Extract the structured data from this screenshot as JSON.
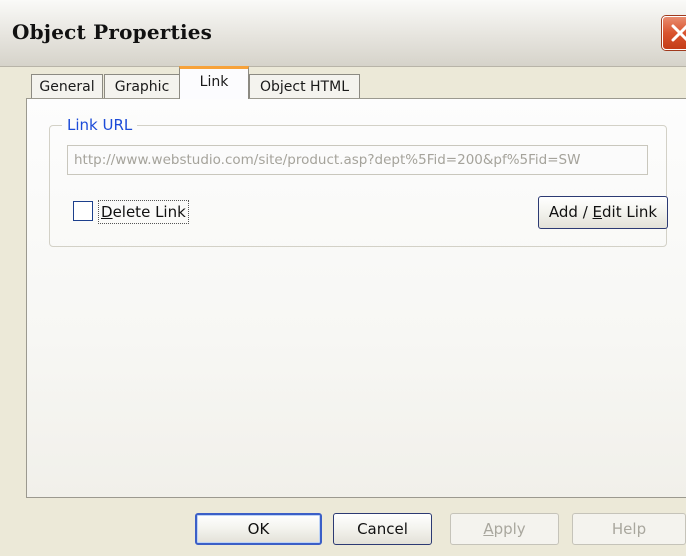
{
  "window": {
    "title": "Object Properties"
  },
  "tabs": [
    {
      "label": "General",
      "active": false
    },
    {
      "label": "Graphic",
      "active": false
    },
    {
      "label": "Link",
      "active": true
    },
    {
      "label": "Object HTML",
      "active": false
    }
  ],
  "link_group": {
    "label": "Link URL",
    "url_value": "http://www.webstudio.com/site/product.asp?dept%5Fid=200&pf%5Fid=SW",
    "delete_link_label_prefix": "",
    "delete_link_mnemonic": "D",
    "delete_link_label_rest": "elete Link",
    "delete_link_checked": false,
    "add_edit_label_prefix": "Add / ",
    "add_edit_mnemonic": "E",
    "add_edit_label_rest": "dit Link"
  },
  "buttons": {
    "ok": "OK",
    "cancel": "Cancel",
    "apply_mnemonic": "A",
    "apply_rest": "pply",
    "help": "Help"
  },
  "icons": {
    "close": "close-icon"
  },
  "colors": {
    "accent_tab": "#f7a23a",
    "group_label": "#1c4bd8",
    "close_button": "#d9542f"
  }
}
